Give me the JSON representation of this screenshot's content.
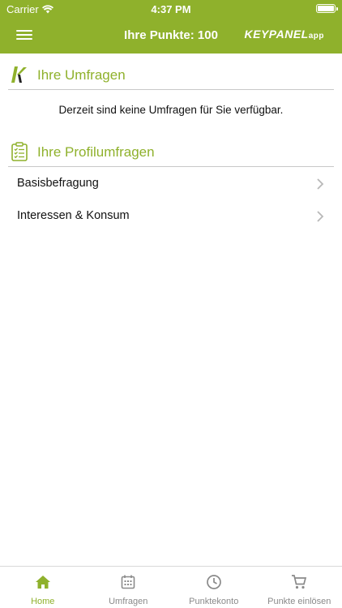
{
  "status_bar": {
    "carrier": "Carrier",
    "time": "4:37 PM"
  },
  "nav": {
    "title": "Ihre Punkte: 100",
    "brand": "KEYPANEL",
    "brand_suffix": "app"
  },
  "surveys": {
    "title": "Ihre Umfragen",
    "empty_message": "Derzeit sind keine Umfragen für Sie verfügbar."
  },
  "profile_surveys": {
    "title": "Ihre Profilumfragen",
    "items": [
      {
        "label": "Basisbefragung"
      },
      {
        "label": "Interessen & Konsum"
      }
    ]
  },
  "tabs": [
    {
      "label": "Home",
      "icon": "home-icon",
      "active": true
    },
    {
      "label": "Umfragen",
      "icon": "calendar-icon",
      "active": false
    },
    {
      "label": "Punktekonto",
      "icon": "clock-icon",
      "active": false
    },
    {
      "label": "Punkte einlösen",
      "icon": "cart-icon",
      "active": false
    }
  ],
  "colors": {
    "accent": "#8fb12c",
    "tab_inactive": "#8a8a8a"
  }
}
